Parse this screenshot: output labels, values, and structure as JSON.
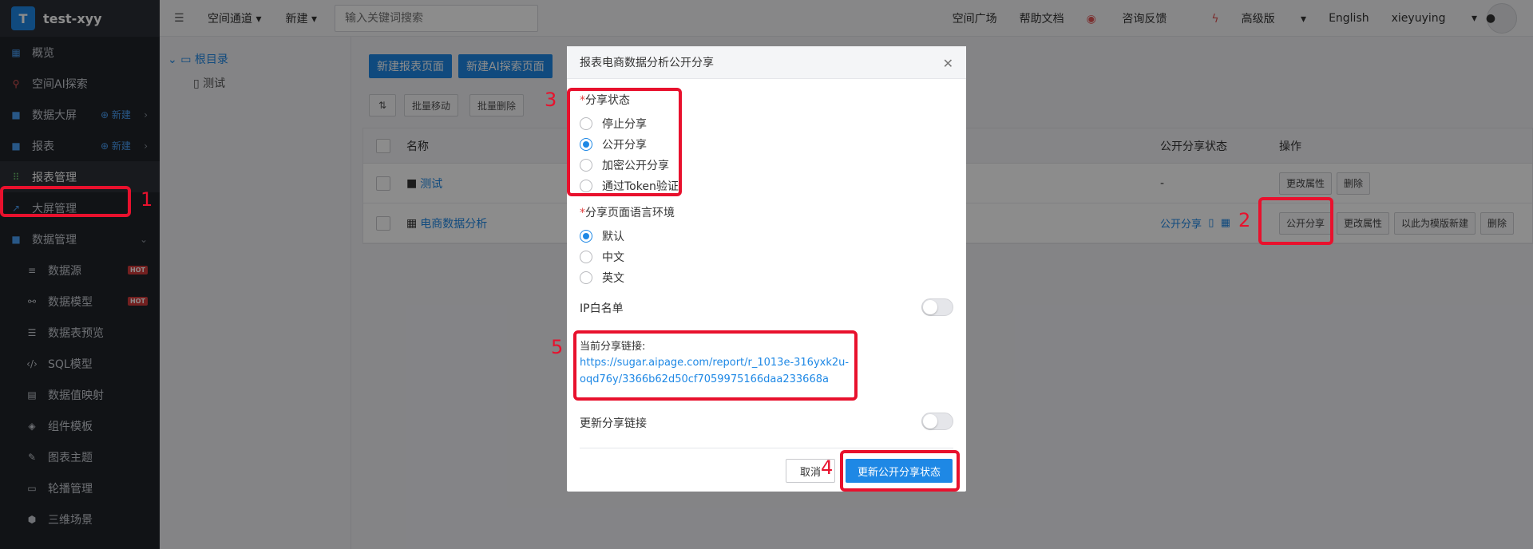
{
  "sidebar": {
    "brand": {
      "logo": "T",
      "name": "test-xyy"
    },
    "items": [
      {
        "label": "概览",
        "icon": "dashboard-icon"
      },
      {
        "label": "空间AI探索",
        "icon": "search-icon"
      },
      {
        "label": "数据大屏",
        "icon": "folder-icon",
        "new": "新建"
      },
      {
        "label": "报表",
        "icon": "folder-icon",
        "new": "新建"
      },
      {
        "label": "报表管理",
        "icon": "grid-icon"
      },
      {
        "label": "大屏管理",
        "icon": "chart-icon"
      },
      {
        "label": "数据管理",
        "icon": "folder-icon"
      },
      {
        "label": "数据源",
        "icon": "database-icon",
        "badge": "HOT"
      },
      {
        "label": "数据模型",
        "icon": "model-icon",
        "badge": "HOT"
      },
      {
        "label": "数据表预览",
        "icon": "list-icon"
      },
      {
        "label": "SQL模型",
        "icon": "code-icon"
      },
      {
        "label": "数据值映射",
        "icon": "book-icon"
      },
      {
        "label": "组件模板",
        "icon": "cube-icon"
      },
      {
        "label": "图表主题",
        "icon": "brush-icon"
      },
      {
        "label": "轮播管理",
        "icon": "monitor-icon"
      },
      {
        "label": "三维场景",
        "icon": "box-icon"
      }
    ]
  },
  "header": {
    "space_channel": "空间通道",
    "new": "新建",
    "search_placeholder": "输入关键词搜索",
    "plaza": "空间广场",
    "help": "帮助文档",
    "feedback": "咨询反馈",
    "edition": "高级版",
    "language": "English",
    "user": "xieyuying"
  },
  "tree": {
    "root": "根目录",
    "child": "测试"
  },
  "main": {
    "new_report": "新建报表页面",
    "new_ai": "新建AI探索页面",
    "batch_move": "批量移动",
    "batch_delete": "批量删除",
    "columns": {
      "name": "名称",
      "share_status": "公开分享状态",
      "actions": "操作"
    },
    "rows": [
      {
        "name": "测试",
        "status": "-",
        "actions": [
          "更改属性",
          "删除"
        ]
      },
      {
        "name": "电商数据分析",
        "status": "公开分享",
        "actions": [
          "公开分享",
          "更改属性",
          "以此为模版新建",
          "删除"
        ]
      }
    ]
  },
  "modal": {
    "title": "报表电商数据分析公开分享",
    "share_status_label": "分享状态",
    "share_options": [
      "停止分享",
      "公开分享",
      "加密公开分享",
      "通过Token验证"
    ],
    "share_selected": 1,
    "lang_label": "分享页面语言环境",
    "lang_options": [
      "默认",
      "中文",
      "英文"
    ],
    "lang_selected": 0,
    "ip_whitelist": "IP白名单",
    "current_link_label": "当前分享链接:",
    "current_link": "https://sugar.aipage.com/report/r_1013e-316yxk2u-oqd76y/3366b62d50cf7059975166daa233668a",
    "update_link": "更新分享链接",
    "cancel": "取消",
    "submit": "更新公开分享状态"
  },
  "annotations": [
    "1",
    "2",
    "3",
    "4",
    "5"
  ],
  "colors": {
    "accent": "#1e88e5",
    "annotation": "#e8112d",
    "sidebar": "#1f2329"
  }
}
